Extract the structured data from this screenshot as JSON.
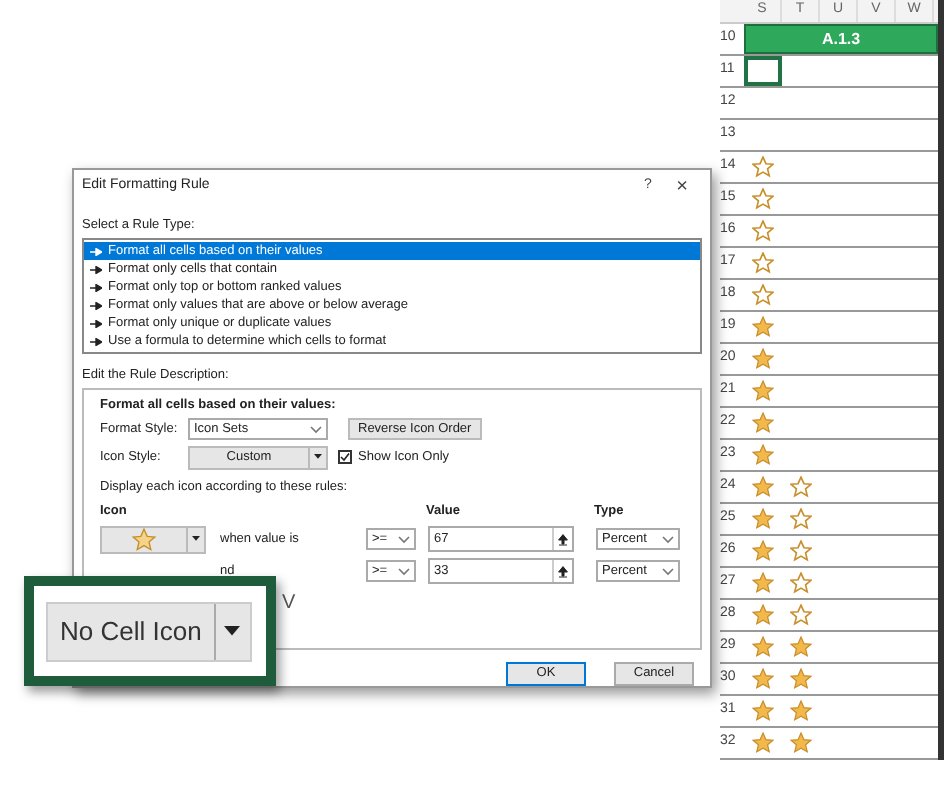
{
  "sheet": {
    "columns": [
      "S",
      "T",
      "U",
      "V",
      "W"
    ],
    "header_row": {
      "number": "10",
      "label": "A.1.3"
    },
    "rows": [
      {
        "number": "11",
        "selected": true,
        "icons": []
      },
      {
        "number": "12",
        "selected": false,
        "icons": []
      },
      {
        "number": "13",
        "selected": false,
        "icons": []
      },
      {
        "number": "14",
        "selected": false,
        "icons": [
          {
            "kind": "empty"
          }
        ]
      },
      {
        "number": "15",
        "selected": false,
        "icons": [
          {
            "kind": "empty"
          }
        ]
      },
      {
        "number": "16",
        "selected": false,
        "icons": [
          {
            "kind": "empty"
          }
        ]
      },
      {
        "number": "17",
        "selected": false,
        "icons": [
          {
            "kind": "empty"
          }
        ]
      },
      {
        "number": "18",
        "selected": false,
        "icons": [
          {
            "kind": "empty"
          }
        ]
      },
      {
        "number": "19",
        "selected": false,
        "icons": [
          {
            "kind": "filled"
          }
        ]
      },
      {
        "number": "20",
        "selected": false,
        "icons": [
          {
            "kind": "filled"
          }
        ]
      },
      {
        "number": "21",
        "selected": false,
        "icons": [
          {
            "kind": "filled"
          }
        ]
      },
      {
        "number": "22",
        "selected": false,
        "icons": [
          {
            "kind": "filled"
          }
        ]
      },
      {
        "number": "23",
        "selected": false,
        "icons": [
          {
            "kind": "filled"
          }
        ]
      },
      {
        "number": "24",
        "selected": false,
        "icons": [
          {
            "kind": "filled"
          },
          {
            "kind": "empty"
          }
        ]
      },
      {
        "number": "25",
        "selected": false,
        "icons": [
          {
            "kind": "filled"
          },
          {
            "kind": "empty"
          }
        ]
      },
      {
        "number": "26",
        "selected": false,
        "icons": [
          {
            "kind": "filled"
          },
          {
            "kind": "empty"
          }
        ]
      },
      {
        "number": "27",
        "selected": false,
        "icons": [
          {
            "kind": "filled"
          },
          {
            "kind": "empty"
          }
        ]
      },
      {
        "number": "28",
        "selected": false,
        "icons": [
          {
            "kind": "filled"
          },
          {
            "kind": "empty"
          }
        ]
      },
      {
        "number": "29",
        "selected": false,
        "icons": [
          {
            "kind": "filled"
          },
          {
            "kind": "filled"
          }
        ]
      },
      {
        "number": "30",
        "selected": false,
        "icons": [
          {
            "kind": "filled"
          },
          {
            "kind": "filled"
          }
        ]
      },
      {
        "number": "31",
        "selected": false,
        "icons": [
          {
            "kind": "filled"
          },
          {
            "kind": "filled"
          }
        ]
      },
      {
        "number": "32",
        "selected": false,
        "icons": [
          {
            "kind": "filled"
          },
          {
            "kind": "filled"
          }
        ]
      }
    ]
  },
  "dialog": {
    "title": "Edit Formatting Rule",
    "help": "?",
    "close": "×",
    "rule_type_label": "Select a Rule Type:",
    "rule_types": [
      {
        "label": "Format all cells based on their values",
        "selected": true
      },
      {
        "label": "Format only cells that contain",
        "selected": false
      },
      {
        "label": "Format only top or bottom ranked values",
        "selected": false
      },
      {
        "label": "Format only values that are above or below average",
        "selected": false
      },
      {
        "label": "Format only unique or duplicate values",
        "selected": false
      },
      {
        "label": "Use a formula to determine which cells to format",
        "selected": false
      }
    ],
    "description_label": "Edit the Rule Description:",
    "description_heading": "Format all cells based on their values:",
    "format_style_label": "Format Style:",
    "format_style": "Icon Sets",
    "reverse_button": "Reverse Icon Order",
    "icon_style_label": "Icon Style:",
    "icon_style": "Custom",
    "show_icon_only": {
      "label": "Show Icon Only",
      "checked": true
    },
    "rules_caption": "Display each icon according to these rules:",
    "columns": {
      "icon": "Icon",
      "value": "Value",
      "type": "Type"
    },
    "icon_rules": [
      {
        "icon": {
          "kind": "half"
        },
        "label": "when value is",
        "operator": ">=",
        "value": "67",
        "type": "Percent"
      },
      {
        "label": "nd",
        "operator": ">=",
        "value": "33",
        "type": "Percent"
      },
      {
        "label": "V"
      }
    ],
    "buttons": [
      "OK",
      "Cancel"
    ]
  },
  "callout": {
    "label": "No Cell Icon"
  }
}
